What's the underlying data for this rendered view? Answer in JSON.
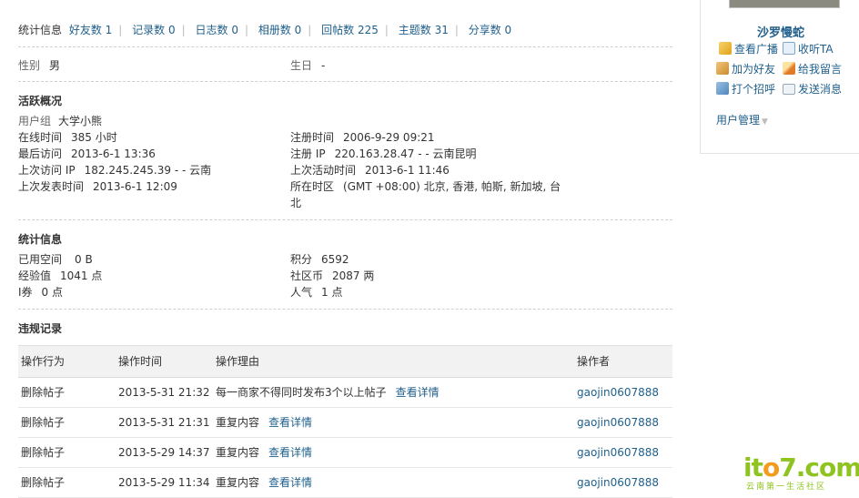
{
  "stats": {
    "label": "统计信息",
    "items": [
      "好友数 1",
      "记录数 0",
      "日志数 0",
      "相册数 0",
      "回帖数 225",
      "主题数 31",
      "分享数 0"
    ]
  },
  "profile": {
    "gender_label": "性别",
    "gender_value": "男",
    "birthday_label": "生日",
    "birthday_value": "-"
  },
  "activity": {
    "title": "活跃概况",
    "usergroup_label": "用户组",
    "usergroup_value": "大学小熊",
    "online_label": "在线时间",
    "online_value": "385 小时",
    "register_label": "注册时间",
    "register_value": "2006-9-29 09:21",
    "lastvisit_label": "最后访问",
    "lastvisit_value": "2013-6-1 13:36",
    "regip_label": "注册 IP",
    "regip_value": "220.163.28.47 - - 云南昆明",
    "lastip_label": "上次访问 IP",
    "lastip_value": "182.245.245.39 - - 云南",
    "lastactive_label": "上次活动时间",
    "lastactive_value": "2013-6-1 11:46",
    "lastpost_label": "上次发表时间",
    "lastpost_value": "2013-6-1 12:09",
    "timezone_label": "所在时区",
    "timezone_value_1": "(GMT +08:00) 北京, 香港, 帕斯, 新加坡, 台",
    "timezone_value_2": "北"
  },
  "statsinfo": {
    "title": "统计信息",
    "space_label": "已用空间",
    "space_value": "0 B",
    "points_label": "积分",
    "points_value": "6592",
    "exp_label": "经验值",
    "exp_value": "1041 点",
    "coins_label": "社区币",
    "coins_value": "2087 两",
    "voucher_label": "I券",
    "voucher_value": "0 点",
    "popularity_label": "人气",
    "popularity_value": "1 点"
  },
  "violations": {
    "title": "违规记录",
    "headers": [
      "操作行为",
      "操作时间",
      "操作理由",
      "操作者"
    ],
    "rows": [
      {
        "action": "删除帖子",
        "time": "2013-5-31 21:32",
        "reason": "每一商家不得同时发布3个以上帖子",
        "detail": "查看详情",
        "operator": "gaojin0607888"
      },
      {
        "action": "删除帖子",
        "time": "2013-5-31 21:31",
        "reason": "重复内容",
        "detail": "查看详情",
        "operator": "gaojin0607888"
      },
      {
        "action": "删除帖子",
        "time": "2013-5-29 14:37",
        "reason": "重复内容",
        "detail": "查看详情",
        "operator": "gaojin0607888"
      },
      {
        "action": "删除帖子",
        "time": "2013-5-29 11:34",
        "reason": "重复内容",
        "detail": "查看详情",
        "operator": "gaojin0607888"
      }
    ]
  },
  "sidebar": {
    "username": "沙罗慢蛇",
    "actions": [
      "查看广播",
      "收听TA",
      "加为好友",
      "给我留言",
      "打个招呼",
      "发送消息"
    ],
    "manage": "用户管理"
  },
  "watermark": {
    "logo_a": "it",
    "logo_b": "o",
    "logo_c": "7.com",
    "sub": "云南第一生活社区"
  },
  "colors": {
    "link": "#1f5f8b",
    "accent_green": "#8fc31f",
    "accent_orange": "#f29b1d"
  }
}
